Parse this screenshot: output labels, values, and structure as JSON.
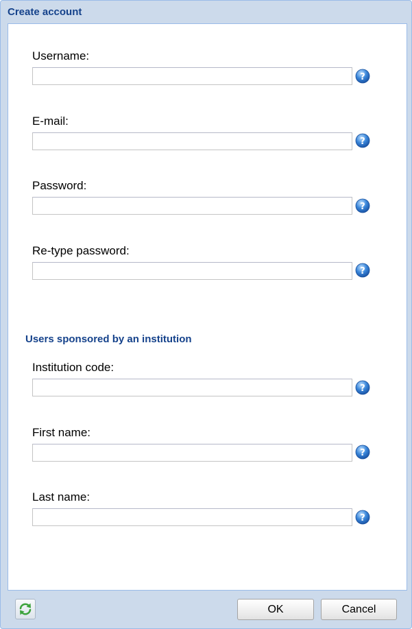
{
  "window": {
    "title": "Create account"
  },
  "fields": {
    "username": {
      "label": "Username:",
      "value": "",
      "placeholder": ""
    },
    "email": {
      "label": "E-mail:",
      "value": "",
      "placeholder": ""
    },
    "password": {
      "label": "Password:",
      "value": "",
      "placeholder": ""
    },
    "retype_password": {
      "label": "Re-type password:",
      "value": "",
      "placeholder": ""
    }
  },
  "sponsored": {
    "heading": "Users sponsored by an institution",
    "institution_code": {
      "label": "Institution code:",
      "value": "",
      "placeholder": ""
    },
    "first_name": {
      "label": "First name:",
      "value": "",
      "placeholder": ""
    },
    "last_name": {
      "label": "Last name:",
      "value": "",
      "placeholder": ""
    }
  },
  "footer": {
    "refresh_icon": "refresh-icon",
    "ok_label": "OK",
    "cancel_label": "Cancel"
  },
  "icons": {
    "help": "help-icon"
  },
  "colors": {
    "title": "#15428b",
    "window_bg": "#ccdaeb",
    "border": "#99bbe8",
    "help_icon": "#3a86d9",
    "refresh_icon": "#3ca33c"
  }
}
